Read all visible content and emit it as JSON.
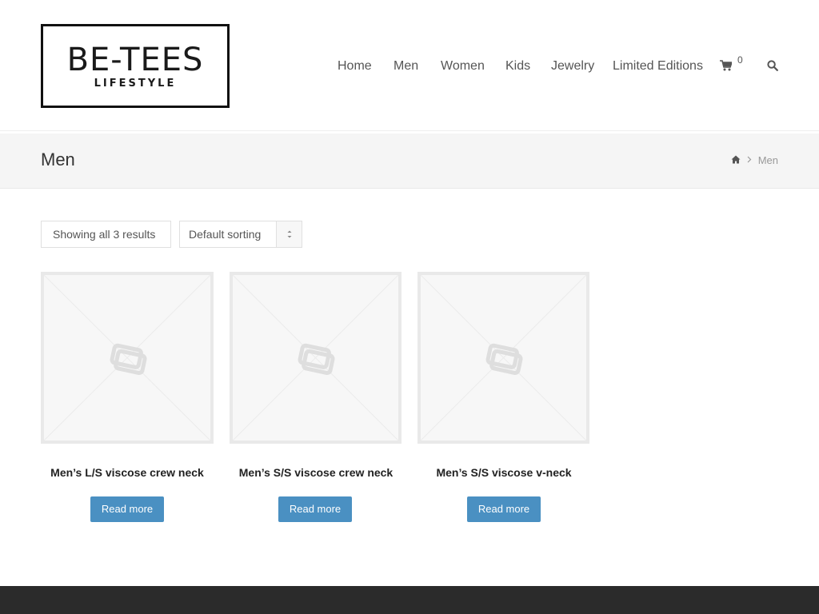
{
  "brand": {
    "name": "BE-TEES",
    "tagline": "LIFESTYLE"
  },
  "nav": {
    "items": [
      {
        "label": "Home"
      },
      {
        "label": "Men"
      },
      {
        "label": "Women"
      },
      {
        "label": "Kids"
      },
      {
        "label": "Jewelry"
      },
      {
        "label": "Limited Editions"
      }
    ],
    "cart_count": "0",
    "icons": [
      "cart-icon",
      "search-icon"
    ]
  },
  "titlebar": {
    "title": "Men",
    "breadcrumb": {
      "home_icon": "home-icon",
      "current": "Men"
    }
  },
  "shop": {
    "result_count": "Showing all 3 results",
    "sorting": {
      "selected": "Default sorting"
    },
    "products": [
      {
        "title": "Men’s L/S viscose crew neck",
        "button": "Read more"
      },
      {
        "title": "Men’s S/S viscose crew neck",
        "button": "Read more"
      },
      {
        "title": "Men’s S/S viscose v-neck",
        "button": "Read more"
      }
    ]
  },
  "colors": {
    "accent": "#4a90c2",
    "footer": "#2b2b2b",
    "titlebar_bg": "#f5f5f5"
  }
}
